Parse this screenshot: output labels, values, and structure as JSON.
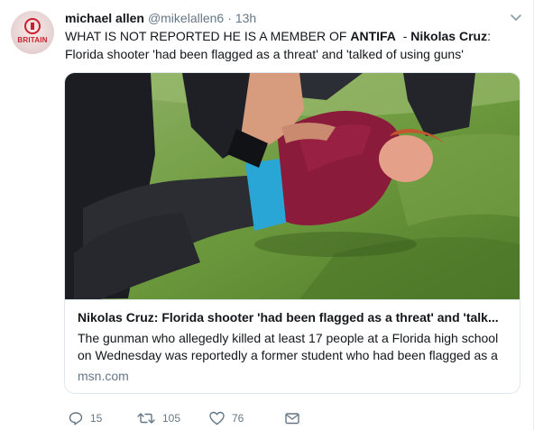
{
  "tweet": {
    "author_name": "michael allen",
    "handle": "@mikelallen6",
    "separator": "·",
    "time": "13h",
    "avatar_text": "BRITAIN",
    "text_part1": "WHAT IS NOT REPORTED HE IS A MEMBER OF ",
    "text_bold1": "ANTIFA",
    "text_part2": "  - ",
    "text_bold2": "Nikolas Cruz",
    "text_part3": ":",
    "text_line2": "Florida shooter 'had been flagged as a threat' and 'talked of using guns'"
  },
  "card": {
    "title": "Nikolas Cruz: Florida shooter 'had been flagged as a threat' and 'talk...",
    "description": "The gunman who allegedly killed at least 17 people at a Florida high school on Wednesday was reportedly a former student who had been flagged as a",
    "domain": "msn.com"
  },
  "actions": {
    "reply_icon": "reply-icon",
    "reply_count": "15",
    "retweet_icon": "retweet-icon",
    "retweet_count": "105",
    "like_icon": "heart-icon",
    "like_count": "76",
    "dm_icon": "envelope-icon"
  },
  "colors": {
    "text": "#14171a",
    "secondary": "#657786",
    "border": "#e1e8ed",
    "shirt": "#8a1b3a",
    "grass": "#5f8f34"
  }
}
